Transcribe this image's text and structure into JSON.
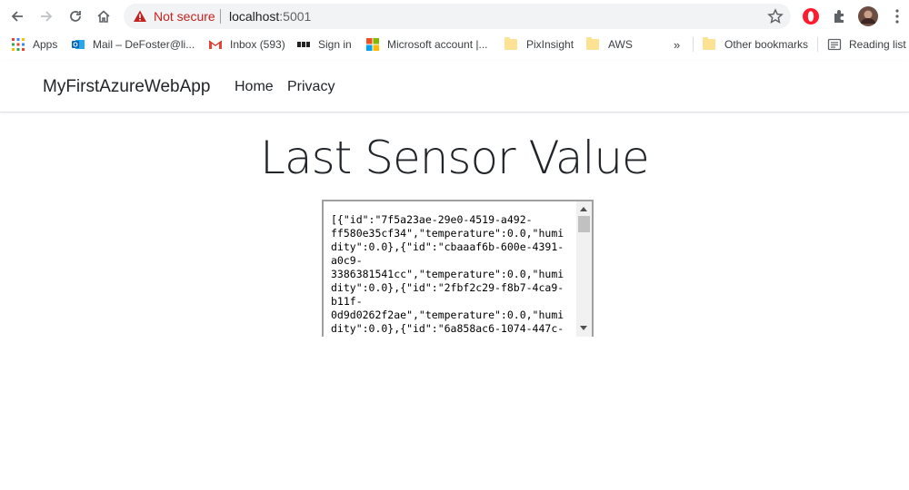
{
  "browser": {
    "security_text": "Not secure",
    "host": "localhost",
    "port": ":5001"
  },
  "bookmarks": {
    "items": [
      {
        "label": "Apps",
        "icon": "apps-grid-icon"
      },
      {
        "label": "Mail – DeFoster@li...",
        "icon": "outlook-icon"
      },
      {
        "label": "Inbox (593)",
        "icon": "gmail-icon"
      },
      {
        "label": "Sign in",
        "icon": "bbc-icon"
      },
      {
        "label": "Microsoft account |...",
        "icon": "microsoft-icon"
      },
      {
        "label": "PixInsight",
        "icon": "folder-icon"
      },
      {
        "label": "AWS",
        "icon": "folder-icon"
      }
    ],
    "overflow": "»",
    "other": "Other bookmarks",
    "reading_list": "Reading list"
  },
  "site": {
    "brand": "MyFirstAzureWebApp",
    "nav": [
      "Home",
      "Privacy"
    ],
    "heading": "Last Sensor Value",
    "sensor_text": "[{\"id\":\"7f5a23ae-29e0-4519-a492-\nff580e35cf34\",\"temperature\":0.0,\"humi\ndity\":0.0},{\"id\":\"cbaaaf6b-600e-4391-\na0c9-\n3386381541cc\",\"temperature\":0.0,\"humi\ndity\":0.0},{\"id\":\"2fbf2c29-f8b7-4ca9-\nb11f-\n0d9d0262f2ae\",\"temperature\":0.0,\"humi\ndity\":0.0},{\"id\":\"6a858ac6-1074-447c-"
  },
  "colors": {
    "warning": "#c5221f",
    "folder": "#fde293"
  }
}
